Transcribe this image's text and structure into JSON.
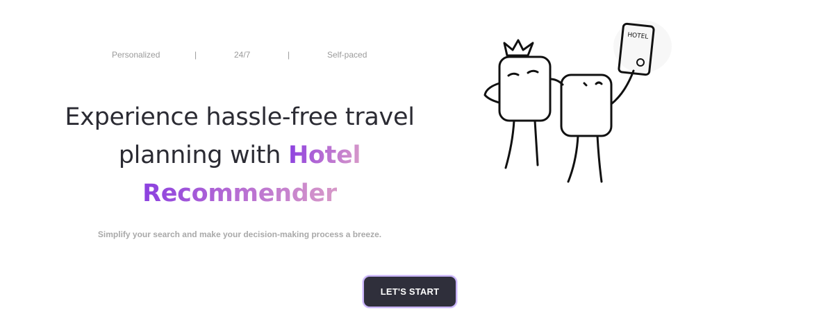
{
  "features": {
    "item1": "Personalized",
    "separator": "|",
    "item2": "24/7",
    "item3": "Self-paced"
  },
  "hero": {
    "headline_line1": "Experience hassle-free travel",
    "headline_line2_prefix": "planning with ",
    "brand_word1": "Hotel",
    "brand_word2": "Recommender",
    "subtitle": "Simplify your search and make your decision-making process a breeze.",
    "cta_label": "LET'S START"
  },
  "illustration": {
    "sign_text": "HOTEL"
  },
  "colors": {
    "brand_gradient_start": "#8a3fe0",
    "brand_gradient_end": "#d89ac8",
    "button_bg": "#2f2f3b",
    "button_border": "#c7b2f7",
    "headline_text": "#2b2b33"
  }
}
